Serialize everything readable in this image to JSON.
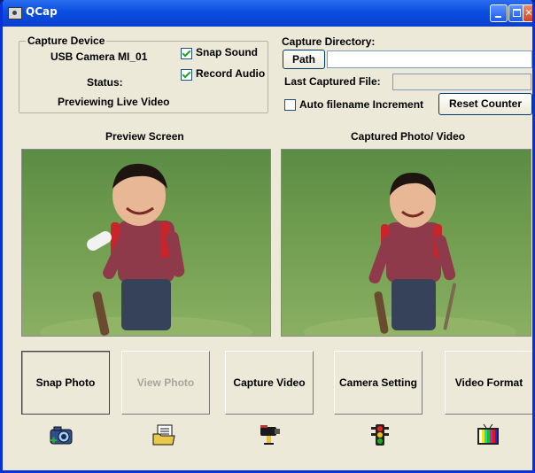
{
  "window": {
    "title": "QCap"
  },
  "capture_device": {
    "legend": "Capture Device",
    "device_name": "USB Camera MI_01",
    "status_label": "Status:",
    "status_value": "Previewing Live Video",
    "snap_sound": {
      "label": "Snap Sound",
      "checked": true
    },
    "record_audio": {
      "label": "Record Audio",
      "checked": true
    }
  },
  "capture_directory": {
    "label": "Capture Directory:",
    "path_button": "Path",
    "path_value": "",
    "last_captured_label": "Last Captured File:",
    "last_captured_value": "",
    "auto_increment": {
      "label": "Auto filename Increment",
      "checked": false
    },
    "reset_button": "Reset Counter"
  },
  "preview": {
    "left_title": "Preview Screen",
    "right_title": "Captured Photo/ Video"
  },
  "actions": [
    {
      "label": "Snap Photo",
      "icon": "camera-snap-icon",
      "state": "pressed"
    },
    {
      "label": "View Photo",
      "icon": "photo-folder-icon",
      "state": "disabled"
    },
    {
      "label": "Capture Video",
      "icon": "video-camera-icon",
      "state": "normal"
    },
    {
      "label": "Camera Setting",
      "icon": "traffic-light-icon",
      "state": "normal"
    },
    {
      "label": "Video Format",
      "icon": "color-bars-tv-icon",
      "state": "normal"
    }
  ],
  "colors": {
    "titlebar": "#0a4ee0",
    "window_bg": "#ece9d8",
    "close_button": "#d4431c"
  }
}
